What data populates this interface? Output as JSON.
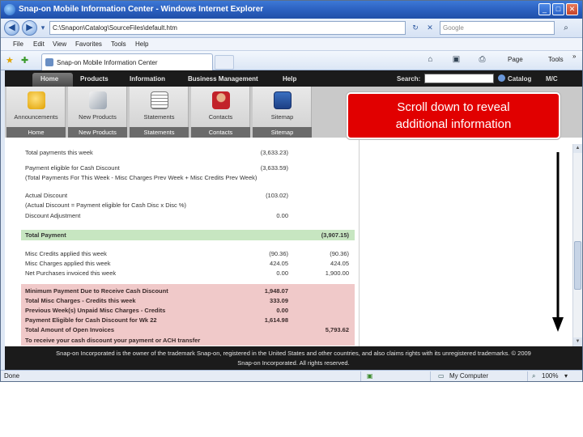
{
  "browser": {
    "window_title": "Snap-on Mobile Information Center - Windows Internet Explorer",
    "address": "C:\\Snapon\\Catalog\\SourceFiles\\default.htm",
    "search_placeholder": "Google",
    "menu": [
      "File",
      "Edit",
      "View",
      "Favorites",
      "Tools",
      "Help"
    ],
    "tab_label": "Snap-on Mobile Information Center",
    "page_cmd": "Page",
    "tools_cmd": "Tools",
    "status_left": "Done",
    "zone": "My Computer",
    "zoom": "100%"
  },
  "site": {
    "nav": [
      "Home",
      "Products",
      "Information",
      "Business Management",
      "Help"
    ],
    "search_label": "Search:",
    "catalog_label": "Catalog",
    "mc_label": "M/C",
    "tiles": [
      {
        "label": "Announcements",
        "sub": "Home",
        "icon": "announcement-icon"
      },
      {
        "label": "New Products",
        "sub": "New Products",
        "icon": "wrench-icon"
      },
      {
        "label": "Statements",
        "sub": "Statements",
        "icon": "statement-icon"
      },
      {
        "label": "Contacts",
        "sub": "Contacts",
        "icon": "contacts-icon"
      },
      {
        "label": "Sitemap",
        "sub": "Sitemap",
        "icon": "sitemap-icon"
      }
    ]
  },
  "statement": {
    "rows": [
      {
        "label": "Total payments this week",
        "v1": "(3,633.23)",
        "v2": ""
      },
      {
        "label": "Payment eligible for Cash Discount",
        "v1": "(3,633.59)",
        "v2": ""
      },
      {
        "label": "(Total Payments For This Week - Misc Charges Prev Week + Misc Credits Prev Week)",
        "v1": "",
        "v2": ""
      },
      {
        "label": "Actual Discount",
        "v1": "(103.02)",
        "v2": ""
      },
      {
        "label": "(Actual Discount = Payment eligible for Cash Disc x Disc %)",
        "v1": "",
        "v2": ""
      },
      {
        "label": "Discount Adjustment",
        "v1": "0.00",
        "v2": ""
      },
      {
        "label": "Total Payment",
        "v1": "",
        "v2": "(3,907.15)"
      },
      {
        "label": "Misc Credits applied this week",
        "v1": "(90.36)",
        "v2": "(90.36)"
      },
      {
        "label": "Misc Charges applied this week",
        "v1": "424.05",
        "v2": "424.05"
      },
      {
        "label": "Net Purchases invoiced this week",
        "v1": "0.00",
        "v2": "1,900.00"
      }
    ],
    "pink_rows": [
      {
        "label": "Minimum Payment Due to Receive Cash Discount",
        "v1": "1,948.07",
        "v2": ""
      },
      {
        "label": "Total Misc Charges - Credits this week",
        "v1": "333.09",
        "v2": ""
      },
      {
        "label": "Previous Week(s) Unpaid Misc Charges - Credits",
        "v1": "0.00",
        "v2": ""
      },
      {
        "label": "Payment Eligible for Cash Discount for Wk 22",
        "v1": "1,614.98",
        "v2": ""
      },
      {
        "label": "Total Amount of Open Invoices",
        "v1": "",
        "v2": "5,793.62"
      },
      {
        "label": "To receive your cash discount your payment or ACH transfer",
        "v1": "",
        "v2": ""
      }
    ]
  },
  "footer": {
    "line1": "Snap-on Incorporated is the owner of the trademark Snap-on, registered in the United States and other countries, and also claims rights with its unregistered trademarks. © 2009",
    "line2": "Snap-on Incorporated. All rights reserved."
  },
  "callout": {
    "line1": "Scroll down to reveal",
    "line2": "additional information"
  }
}
